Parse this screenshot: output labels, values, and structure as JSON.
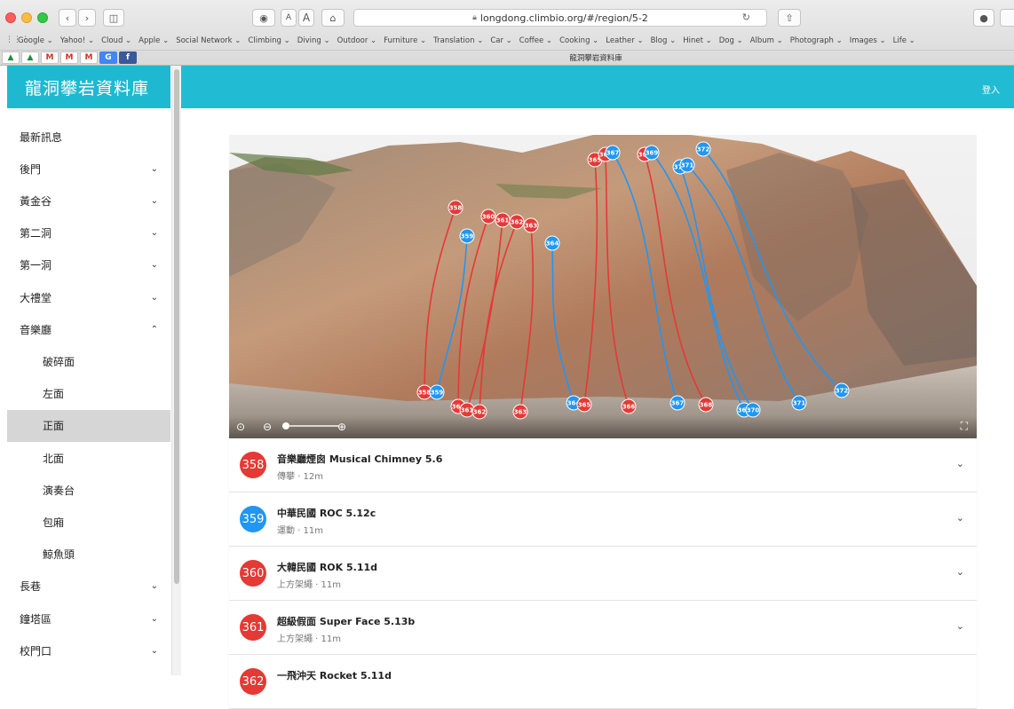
{
  "browser": {
    "url": "longdong.climbio.org/#/region/5-2",
    "tab_title": "龍洞攀岩資料庫",
    "btn_back": "‹",
    "btn_forward": "›",
    "btn_sidebar": "◫",
    "btn_reader": "◉",
    "btn_text_small": "A",
    "btn_text_large": "A",
    "btn_home": "⌂",
    "reload": "↻",
    "share": "⇧",
    "bookmarks": [
      "Google ⌄",
      "Yahoo! ⌄",
      "Cloud ⌄",
      "Apple ⌄",
      "Social Network ⌄",
      "Climbing ⌄",
      "Diving ⌄",
      "Outdoor ⌄",
      "Furniture ⌄",
      "Translation ⌄",
      "Car ⌄",
      "Coffee ⌄",
      "Cooking ⌄",
      "Leather ⌄",
      "Blog ⌄",
      "Hinet ⌄",
      "Dog ⌄",
      "Album ⌄",
      "Photograph ⌄",
      "Images ⌄",
      "Life ⌄"
    ],
    "favicons": [
      {
        "icon": "drive-icon",
        "glyph": "▲",
        "kind": "drive"
      },
      {
        "icon": "drive-icon",
        "glyph": "▲",
        "kind": "drive"
      },
      {
        "icon": "gmail-icon",
        "glyph": "M",
        "kind": "gmail"
      },
      {
        "icon": "gmail-icon",
        "glyph": "M",
        "kind": "gmail"
      },
      {
        "icon": "gmail-icon",
        "glyph": "M",
        "kind": "gmail"
      },
      {
        "icon": "translate-icon",
        "glyph": "G",
        "kind": "trans"
      },
      {
        "icon": "facebook-icon",
        "glyph": "f",
        "kind": "fb"
      }
    ]
  },
  "app": {
    "title": "龍洞攀岩資料庫",
    "login": "登入"
  },
  "sidebar": {
    "items": [
      {
        "label": "最新訊息",
        "chevron": "",
        "sub": false,
        "active": false
      },
      {
        "label": "後門",
        "chevron": "⌄",
        "sub": false,
        "active": false
      },
      {
        "label": "黃金谷",
        "chevron": "⌄",
        "sub": false,
        "active": false
      },
      {
        "label": "第二洞",
        "chevron": "⌄",
        "sub": false,
        "active": false
      },
      {
        "label": "第一洞",
        "chevron": "⌄",
        "sub": false,
        "active": false
      },
      {
        "label": "大禮堂",
        "chevron": "⌄",
        "sub": false,
        "active": false
      },
      {
        "label": "音樂廳",
        "chevron": "⌃",
        "sub": false,
        "active": false
      },
      {
        "label": "破碎面",
        "chevron": "",
        "sub": true,
        "active": false
      },
      {
        "label": "左面",
        "chevron": "",
        "sub": true,
        "active": false
      },
      {
        "label": "正面",
        "chevron": "",
        "sub": true,
        "active": true
      },
      {
        "label": "北面",
        "chevron": "",
        "sub": true,
        "active": false
      },
      {
        "label": "演奏台",
        "chevron": "",
        "sub": true,
        "active": false
      },
      {
        "label": "包廂",
        "chevron": "",
        "sub": true,
        "active": false
      },
      {
        "label": "鯨魚頭",
        "chevron": "",
        "sub": true,
        "active": false
      },
      {
        "label": "長巷",
        "chevron": "⌄",
        "sub": false,
        "active": false
      },
      {
        "label": "鐘塔區",
        "chevron": "⌄",
        "sub": false,
        "active": false
      },
      {
        "label": "校門口",
        "chevron": "⌄",
        "sub": false,
        "active": false
      }
    ]
  },
  "colors": {
    "red": "#e53935",
    "blue": "#2196f3",
    "accent": "#21bcd3"
  },
  "panorama": {
    "markers": [
      {
        "n": "358",
        "c": "red"
      },
      {
        "n": "359",
        "c": "blue"
      },
      {
        "n": "360",
        "c": "red"
      },
      {
        "n": "361",
        "c": "red"
      },
      {
        "n": "362",
        "c": "red"
      },
      {
        "n": "363",
        "c": "red"
      },
      {
        "n": "364",
        "c": "blue"
      },
      {
        "n": "365",
        "c": "red"
      },
      {
        "n": "366",
        "c": "red"
      },
      {
        "n": "367",
        "c": "blue"
      },
      {
        "n": "368",
        "c": "red"
      },
      {
        "n": "369",
        "c": "blue"
      },
      {
        "n": "370",
        "c": "blue"
      },
      {
        "n": "371",
        "c": "blue"
      },
      {
        "n": "372",
        "c": "blue"
      }
    ],
    "zoom_level": 0.0
  },
  "routes": [
    {
      "n": "358",
      "color": "red",
      "name": "音樂廳煙囪 Musical Chimney 5.6",
      "meta": "傳攀 · 12m"
    },
    {
      "n": "359",
      "color": "blue",
      "name": "中華民國 ROC 5.12c",
      "meta": "運動 · 11m"
    },
    {
      "n": "360",
      "color": "red",
      "name": "大韓民國 ROK 5.11d",
      "meta": "上方架繩 · 11m"
    },
    {
      "n": "361",
      "color": "red",
      "name": "超級假面 Super Face 5.13b",
      "meta": "上方架繩 · 11m"
    },
    {
      "n": "362",
      "color": "red",
      "name": "一飛沖天 Rocket 5.11d",
      "meta": ""
    }
  ]
}
